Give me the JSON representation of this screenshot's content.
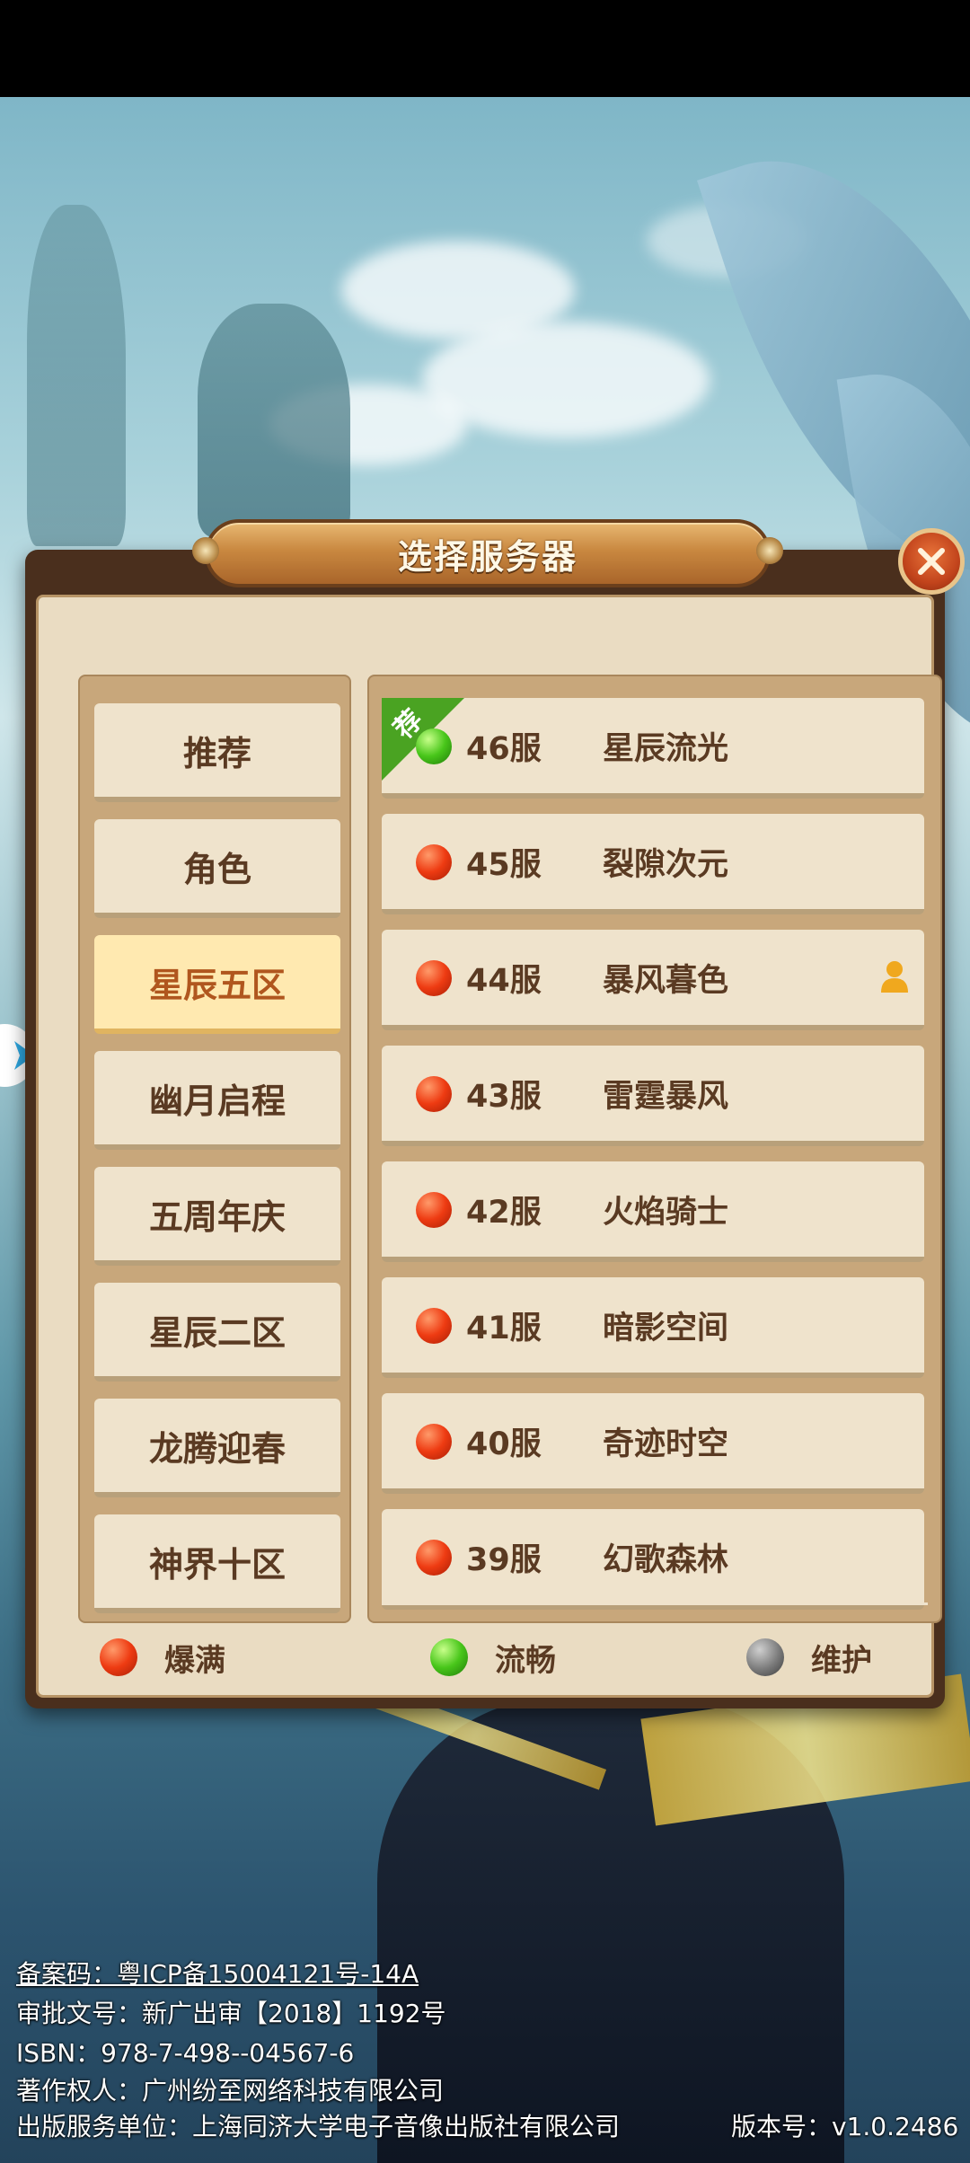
{
  "dialog": {
    "title": "选择服务器",
    "close_icon": "close-icon"
  },
  "categories": [
    {
      "label": "推荐",
      "active": false
    },
    {
      "label": "角色",
      "active": false
    },
    {
      "label": "星辰五区",
      "active": true
    },
    {
      "label": "幽月启程",
      "active": false
    },
    {
      "label": "五周年庆",
      "active": false
    },
    {
      "label": "星辰二区",
      "active": false
    },
    {
      "label": "龙腾迎春",
      "active": false
    },
    {
      "label": "神界十区",
      "active": false
    }
  ],
  "servers": [
    {
      "num": "46服",
      "name": "星辰流光",
      "status": "green",
      "recommended": true,
      "tag": "荐",
      "has_role": false
    },
    {
      "num": "45服",
      "name": "裂隙次元",
      "status": "red",
      "recommended": false,
      "has_role": false
    },
    {
      "num": "44服",
      "name": "暴风暮色",
      "status": "red",
      "recommended": false,
      "has_role": true
    },
    {
      "num": "43服",
      "name": "雷霆暴风",
      "status": "red",
      "recommended": false,
      "has_role": false
    },
    {
      "num": "42服",
      "name": "火焰骑士",
      "status": "red",
      "recommended": false,
      "has_role": false
    },
    {
      "num": "41服",
      "name": "暗影空间",
      "status": "red",
      "recommended": false,
      "has_role": false
    },
    {
      "num": "40服",
      "name": "奇迹时空",
      "status": "red",
      "recommended": false,
      "has_role": false
    },
    {
      "num": "39服",
      "name": "幻歌森林",
      "status": "red",
      "recommended": false,
      "has_role": false
    }
  ],
  "legend": [
    {
      "label": "爆满",
      "status": "red"
    },
    {
      "label": "流畅",
      "status": "green"
    },
    {
      "label": "维护",
      "status": "gray"
    }
  ],
  "footer": {
    "icp": "备案码：粤ICP备15004121号-14A",
    "approval": "审批文号：新广出审【2018】1192号",
    "isbn": "ISBN：978-7-498--04567-6",
    "copyright": "著作权人：广州纷至网络科技有限公司",
    "publisher": "出版服务单位：上海同济大学电子音像出版社有限公司",
    "version": "版本号：v1.0.2486"
  },
  "colors": {
    "panel_bg": "#eadcc2",
    "text_brown": "#5a3a22",
    "active_tab": "#ffe9b0",
    "status_full": "#ee3b12",
    "status_smooth": "#48c61a",
    "status_maintenance": "#7a7a7a"
  }
}
